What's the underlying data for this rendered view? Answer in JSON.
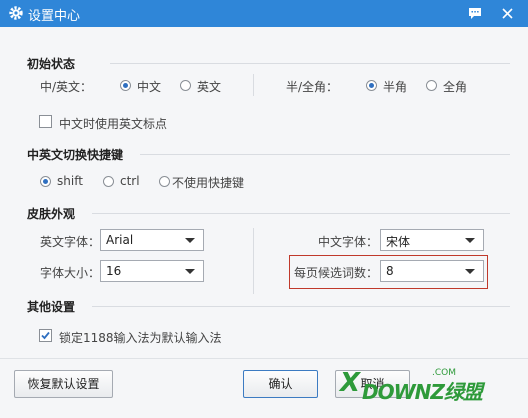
{
  "window": {
    "title": "设置中心"
  },
  "sections": {
    "initial_state": "初始状态",
    "hotkey": "中英文切换快捷键",
    "skin": "皮肤外观",
    "other": "其他设置"
  },
  "initial_state": {
    "lang_label": "中/英文：",
    "lang_options": [
      "中文",
      "英文"
    ],
    "lang_selected": "中文",
    "width_label": "半/全角：",
    "width_options": [
      "半角",
      "全角"
    ],
    "width_selected": "半角",
    "punct_checkbox": "中文时使用英文标点",
    "punct_checked": false
  },
  "hotkey": {
    "options": [
      "shift",
      "ctrl",
      "不使用快捷键"
    ],
    "selected": "shift"
  },
  "skin": {
    "en_font_label": "英文字体：",
    "en_font_value": "Arial",
    "cn_font_label": "中文字体：",
    "cn_font_value": "宋体",
    "size_label": "字体大小：",
    "size_value": "16",
    "candidates_label": "每页候选词数：",
    "candidates_value": "8"
  },
  "other": {
    "lock_checkbox": "锁定1188输入法为默认输入法",
    "lock_checked": true
  },
  "footer": {
    "restore_button": "恢复默认设置",
    "ok_button": "确认",
    "cancel_button": "取消"
  },
  "watermark": {
    "text": "DOWNZ绿盟",
    "prefix": "X",
    "suffix": ".COM"
  },
  "colors": {
    "titlebar": "#2f86d8",
    "highlight": "#c0392b",
    "watermark_green": "#2e9a3a"
  }
}
